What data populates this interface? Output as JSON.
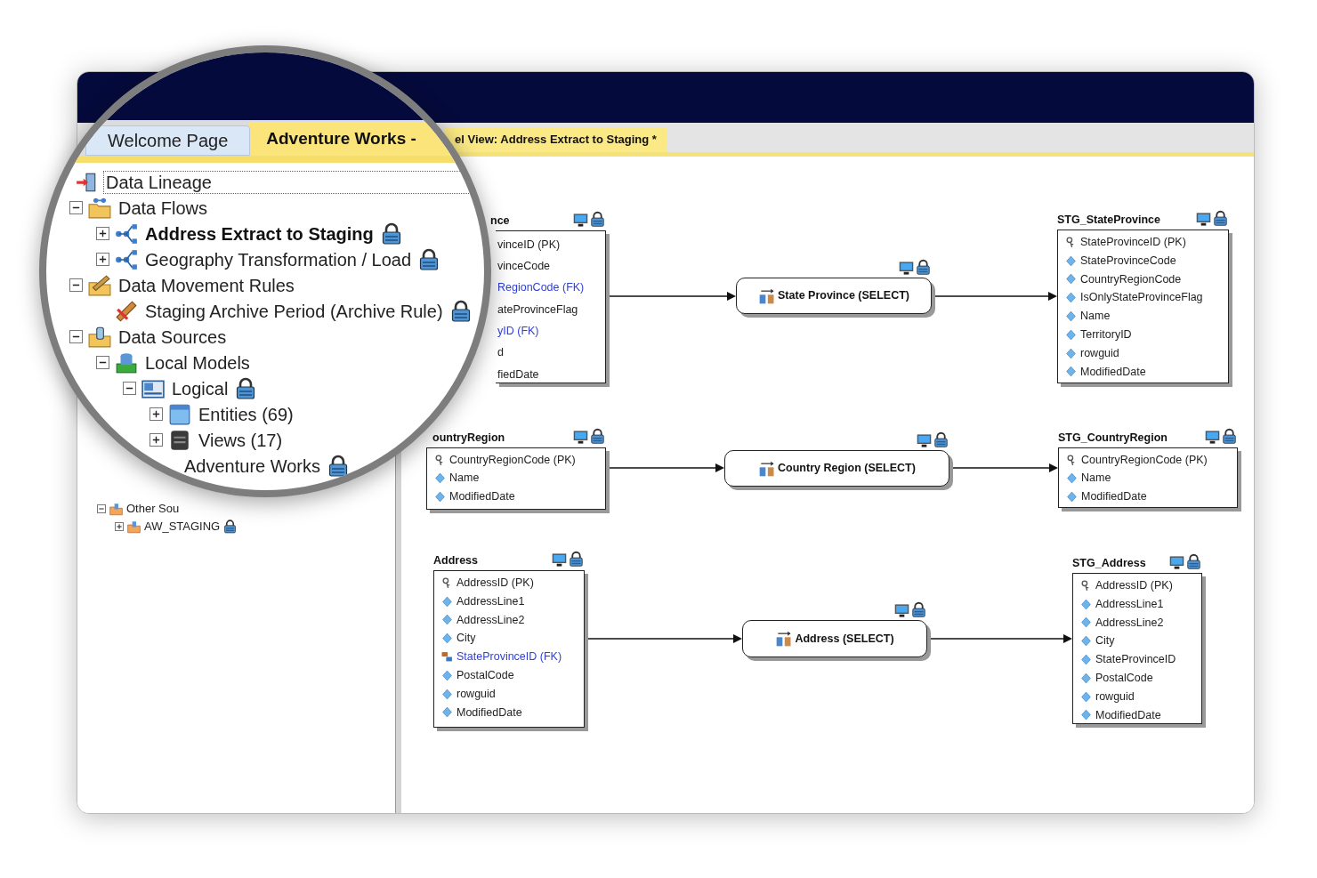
{
  "tabs": [
    {
      "label": "Welcome Page",
      "selected": false
    },
    {
      "label": "Adventure Works -",
      "selected": true
    }
  ],
  "document_tab": {
    "label": "el View: Address Extract to Staging *"
  },
  "tree": [
    {
      "label": "Data Lineage",
      "kind": "lineage",
      "focused": true,
      "active": false,
      "children": [
        {
          "label": "Data Flows",
          "kind": "flows_folder",
          "expanded": true,
          "focused": false,
          "active": false,
          "children": [
            {
              "label": "Address Extract to Staging",
              "kind": "flow",
              "expanded": false,
              "locked": true,
              "focused": false,
              "active": true
            },
            {
              "label": "Geography Transformation / Load",
              "kind": "flow",
              "expanded": false,
              "locked": true,
              "focused": false,
              "active": false
            }
          ]
        },
        {
          "label": "Data Movement Rules",
          "kind": "rules_folder",
          "expanded": true,
          "focused": false,
          "active": false,
          "children": [
            {
              "label": "Staging Archive Period (Archive Rule)",
              "kind": "rule",
              "locked": true,
              "focused": false,
              "active": false
            }
          ]
        },
        {
          "label": "Data Sources",
          "kind": "sources_folder",
          "expanded": true,
          "focused": false,
          "active": false,
          "children": [
            {
              "label": "Local Models",
              "kind": "local_models",
              "expanded": true,
              "focused": false,
              "active": false,
              "children": [
                {
                  "label": "Logical",
                  "kind": "logical",
                  "expanded": true,
                  "locked": true,
                  "focused": false,
                  "active": false,
                  "children": [
                    {
                      "label": "Entities (69)",
                      "kind": "entities",
                      "expanded": false,
                      "focused": false,
                      "active": false
                    },
                    {
                      "label": "Views (17)",
                      "kind": "views",
                      "expanded": false,
                      "focused": false,
                      "active": false
                    }
                  ]
                },
                {
                  "label": "Adventure Works",
                  "kind": "model",
                  "locked": true,
                  "focused": false,
                  "active": false
                }
              ]
            }
          ]
        }
      ]
    }
  ],
  "background_tree": [
    {
      "label": "Other Sou",
      "expanded": true,
      "children": [
        {
          "label": "AW_STAGING",
          "expanded": false,
          "locked": true
        }
      ]
    }
  ],
  "diagram": {
    "tables": [
      {
        "title": "nce",
        "cut": true,
        "rows": [
          {
            "text": "vinceID (PK)",
            "kind": "pk"
          },
          {
            "text": "vinceCode",
            "kind": "attr"
          },
          {
            "text": "RegionCode (FK)",
            "kind": "fk"
          },
          {
            "text": "ateProvinceFlag",
            "kind": "attr"
          },
          {
            "text": "yID (FK)",
            "kind": "fk"
          },
          {
            "text": "d",
            "kind": "attr"
          },
          {
            "text": "fiedDate",
            "kind": "attr"
          }
        ]
      },
      {
        "title": "STG_StateProvince",
        "cut": false,
        "rows": [
          {
            "text": "StateProvinceID (PK)",
            "kind": "pk"
          },
          {
            "text": "StateProvinceCode",
            "kind": "attr"
          },
          {
            "text": "CountryRegionCode",
            "kind": "attr"
          },
          {
            "text": "IsOnlyStateProvinceFlag",
            "kind": "attr"
          },
          {
            "text": "Name",
            "kind": "attr"
          },
          {
            "text": "TerritoryID",
            "kind": "attr"
          },
          {
            "text": "rowguid",
            "kind": "attr"
          },
          {
            "text": "ModifiedDate",
            "kind": "attr"
          }
        ]
      },
      {
        "title": "ountryRegion",
        "cut": false,
        "rows": [
          {
            "text": "CountryRegionCode (PK)",
            "kind": "pk"
          },
          {
            "text": "Name",
            "kind": "attr"
          },
          {
            "text": "ModifiedDate",
            "kind": "attr"
          }
        ]
      },
      {
        "title": "STG_CountryRegion",
        "cut": false,
        "rows": [
          {
            "text": "CountryRegionCode (PK)",
            "kind": "pk"
          },
          {
            "text": "Name",
            "kind": "attr"
          },
          {
            "text": "ModifiedDate",
            "kind": "attr"
          }
        ]
      },
      {
        "title": "Address",
        "cut": false,
        "rows": [
          {
            "text": "AddressID (PK)",
            "kind": "pk"
          },
          {
            "text": "AddressLine1",
            "kind": "attr"
          },
          {
            "text": "AddressLine2",
            "kind": "attr"
          },
          {
            "text": "City",
            "kind": "attr"
          },
          {
            "text": "StateProvinceID (FK)",
            "kind": "fk"
          },
          {
            "text": "PostalCode",
            "kind": "attr"
          },
          {
            "text": "rowguid",
            "kind": "attr"
          },
          {
            "text": "ModifiedDate",
            "kind": "attr"
          }
        ]
      },
      {
        "title": "STG_Address",
        "cut": false,
        "rows": [
          {
            "text": "AddressID (PK)",
            "kind": "pk"
          },
          {
            "text": "AddressLine1",
            "kind": "attr"
          },
          {
            "text": "AddressLine2",
            "kind": "attr"
          },
          {
            "text": "City",
            "kind": "attr"
          },
          {
            "text": "StateProvinceID",
            "kind": "attr"
          },
          {
            "text": "PostalCode",
            "kind": "attr"
          },
          {
            "text": "rowguid",
            "kind": "attr"
          },
          {
            "text": "ModifiedDate",
            "kind": "attr"
          }
        ]
      }
    ],
    "transforms": [
      {
        "label": "State Province (SELECT)"
      },
      {
        "label": "Country Region (SELECT)"
      },
      {
        "label": "Address (SELECT)"
      }
    ]
  }
}
